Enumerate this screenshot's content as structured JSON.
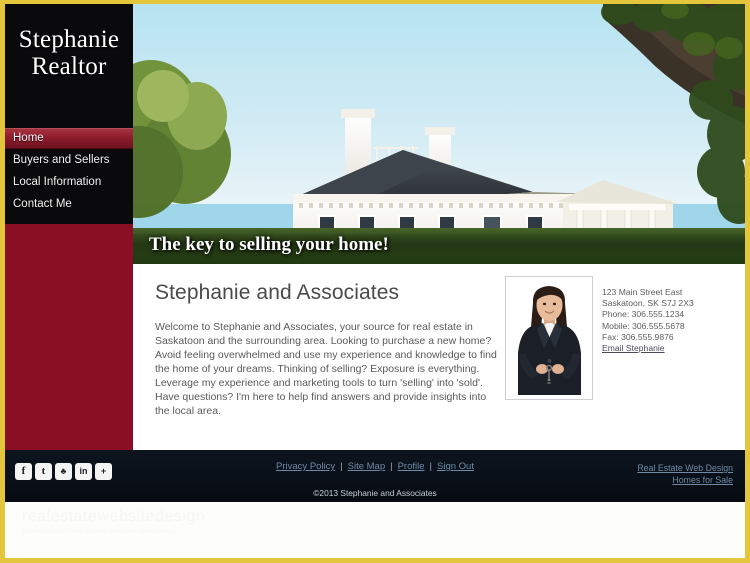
{
  "site": {
    "brand_line1": "Stephanie",
    "brand_line2": "Realtor",
    "tagline": "The key to selling your home!"
  },
  "nav": {
    "items": [
      {
        "label": "Home",
        "active": true
      },
      {
        "label": "Buyers and Sellers",
        "active": false
      },
      {
        "label": "Local Information",
        "active": false
      },
      {
        "label": "Contact Me",
        "active": false
      }
    ]
  },
  "main": {
    "title": "Stephanie and Associates",
    "body": "Welcome to Stephanie and Associates, your source for real estate in Saskatoon and the surrounding area. Looking to purchase a new home? Avoid feeling overwhelmed and use my experience and knowledge to find the home of your dreams. Thinking of selling? Exposure is everything. Leverage my experience and marketing tools to turn 'selling' into 'sold'. Have questions? I'm here to help find answers and provide insights into the local area."
  },
  "contact": {
    "street": "123 Main Street East",
    "city": "Saskatoon, SK S7J 2X3",
    "phone": "Phone: 306.555.1234",
    "mobile": "Mobile: 306.555.5678",
    "fax": "Fax: 306.555.9876",
    "email_label": "Email Stephanie"
  },
  "footer": {
    "links": [
      {
        "label": "Privacy Policy"
      },
      {
        "label": "Site Map"
      },
      {
        "label": "Profile"
      },
      {
        "label": "Sign Out"
      }
    ],
    "separator": "|",
    "copyright": "©2013 Stephanie and Associates",
    "credits": [
      {
        "label": "Real Estate Web Design"
      },
      {
        "label": "Homes for Sale"
      }
    ],
    "social": [
      {
        "name": "facebook-icon",
        "glyph": "f"
      },
      {
        "name": "twitter-icon",
        "glyph": "t"
      },
      {
        "name": "myspace-icon",
        "glyph": "♣"
      },
      {
        "name": "linkedin-icon",
        "glyph": "in"
      },
      {
        "name": "share-more-icon",
        "glyph": "+"
      }
    ]
  },
  "watermark": {
    "line1": "realestatewebsitedesign",
    "line2": "professional real estate website templates"
  },
  "colors": {
    "frame": "#e3c63c",
    "sidebar_maroon": "#8a0f24",
    "nav_bg": "#0a0a0c",
    "nav_active": "#8f1c2c",
    "footer_bg": "#0a1019",
    "link": "#6f8aa6"
  }
}
